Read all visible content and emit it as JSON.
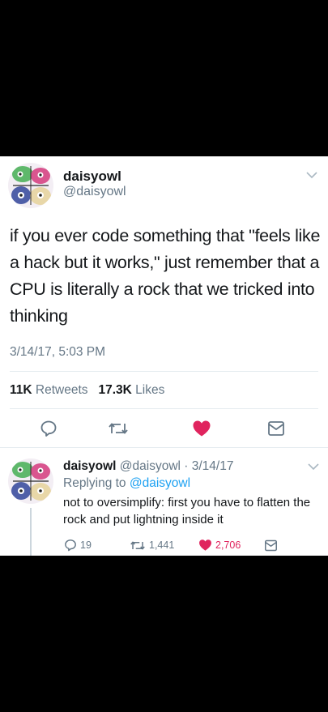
{
  "tweet": {
    "author_name": "daisyowl",
    "author_handle": "@daisyowl",
    "text": "if you ever code something that \"feels like a hack but it works,\" just remember that a CPU is literally a rock that we tricked into thinking",
    "timestamp": "3/14/17, 5:03 PM",
    "retweets_count": "11K",
    "retweets_label": "Retweets",
    "likes_count": "17.3K",
    "likes_label": "Likes",
    "actions": [
      "reply-icon",
      "retweet-icon",
      "heart-icon",
      "message-icon"
    ],
    "like_color": "#e0245e"
  },
  "reply": {
    "author_name": "daisyowl",
    "author_handle": "@daisyowl",
    "separator": " · ",
    "date": "3/14/17",
    "replying_label": "Replying to",
    "replying_to": "@daisyowl",
    "text": "not to oversimplify: first you have to flatten the rock and put lightning inside it",
    "replies": "19",
    "retweets": "1,441",
    "likes": "2,706"
  },
  "colors": {
    "background": "#000000",
    "card": "#ffffff",
    "text": "#14171a",
    "muted": "#657786",
    "link": "#1da1f2",
    "like": "#e0245e",
    "divider": "#e6ecf0"
  }
}
